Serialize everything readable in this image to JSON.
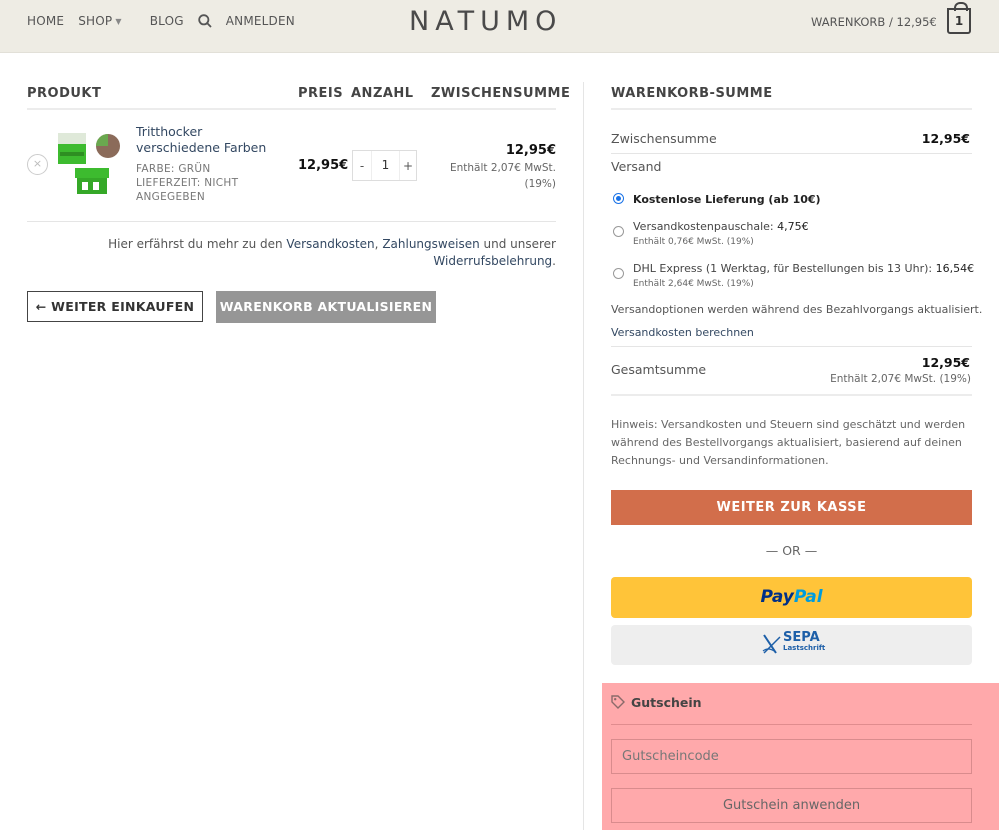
{
  "header": {
    "nav": [
      "HOME",
      "SHOP",
      "BLOG",
      "ANMELDEN"
    ],
    "logo": "NATUMO",
    "cart_label": "WARENKORB / 12,95€",
    "cart_count": "1"
  },
  "cart": {
    "columns": {
      "product": "PRODUKT",
      "price": "PREIS",
      "qty": "ANZAHL",
      "subtotal": "ZWISCHENSUMME"
    },
    "item": {
      "name": "Tritthocker verschiedene Farben",
      "color_label": "FARBE:",
      "color_value": "GRÜN",
      "delivery_label": "LIEFERZEIT:",
      "delivery_value": "NICHT ANGEGEBEN",
      "price": "12,95€",
      "qty": "1",
      "minus": "-",
      "plus": "+",
      "subtotal": "12,95€",
      "tax_note_1": "Enthält 2,07€ MwSt.",
      "tax_note_2": "(19%)",
      "remove": "×"
    },
    "info_prefix": "Hier erfährst du mehr zu den",
    "info_link1": "Versandkosten",
    "info_sep": ",",
    "info_link2": "Zahlungsweisen",
    "info_mid": "und unserer",
    "info_link3": "Widerrufsbelehrung",
    "info_end": ".",
    "continue_btn": "← WEITER EINKAUFEN",
    "update_btn": "WARENKORB AKTUALISIEREN"
  },
  "totals": {
    "title": "WARENKORB-SUMME",
    "subtotal_label": "Zwischensumme",
    "subtotal_value": "12,95€",
    "shipping_label": "Versand",
    "options": [
      {
        "label": "Kostenlose Lieferung (ab 10€)",
        "price": "",
        "note": ""
      },
      {
        "label": "Versandkostenpauschale:",
        "price": "4,75€",
        "note": "Enthält 0,76€ MwSt. (19%)"
      },
      {
        "label": "DHL Express (1 Werktag, für Bestellungen bis 13 Uhr):",
        "price": "16,54€",
        "note": "Enthält 2,64€ MwSt. (19%)"
      }
    ],
    "shipping_update": "Versandoptionen werden während des Bezahlvorgangs aktualisiert.",
    "calc_link": "Versandkosten berechnen",
    "total_label": "Gesamtsumme",
    "total_value": "12,95€",
    "total_note": "Enthält 2,07€ MwSt. (19%)",
    "hint": "Hinweis: Versandkosten und Steuern sind geschätzt und werden während des Bestellvorgangs aktualisiert, basierend auf deinen Rechnungs- und Versandinformationen.",
    "checkout_btn": "WEITER ZUR KASSE",
    "or": "— OR —",
    "paypal_1": "Pay",
    "paypal_2": "Pal",
    "sepa_title": "SEPA",
    "sepa_sub": "Lastschrift"
  },
  "coupon": {
    "title": "Gutschein",
    "placeholder": "Gutscheincode",
    "apply_btn": "Gutschein anwenden"
  }
}
